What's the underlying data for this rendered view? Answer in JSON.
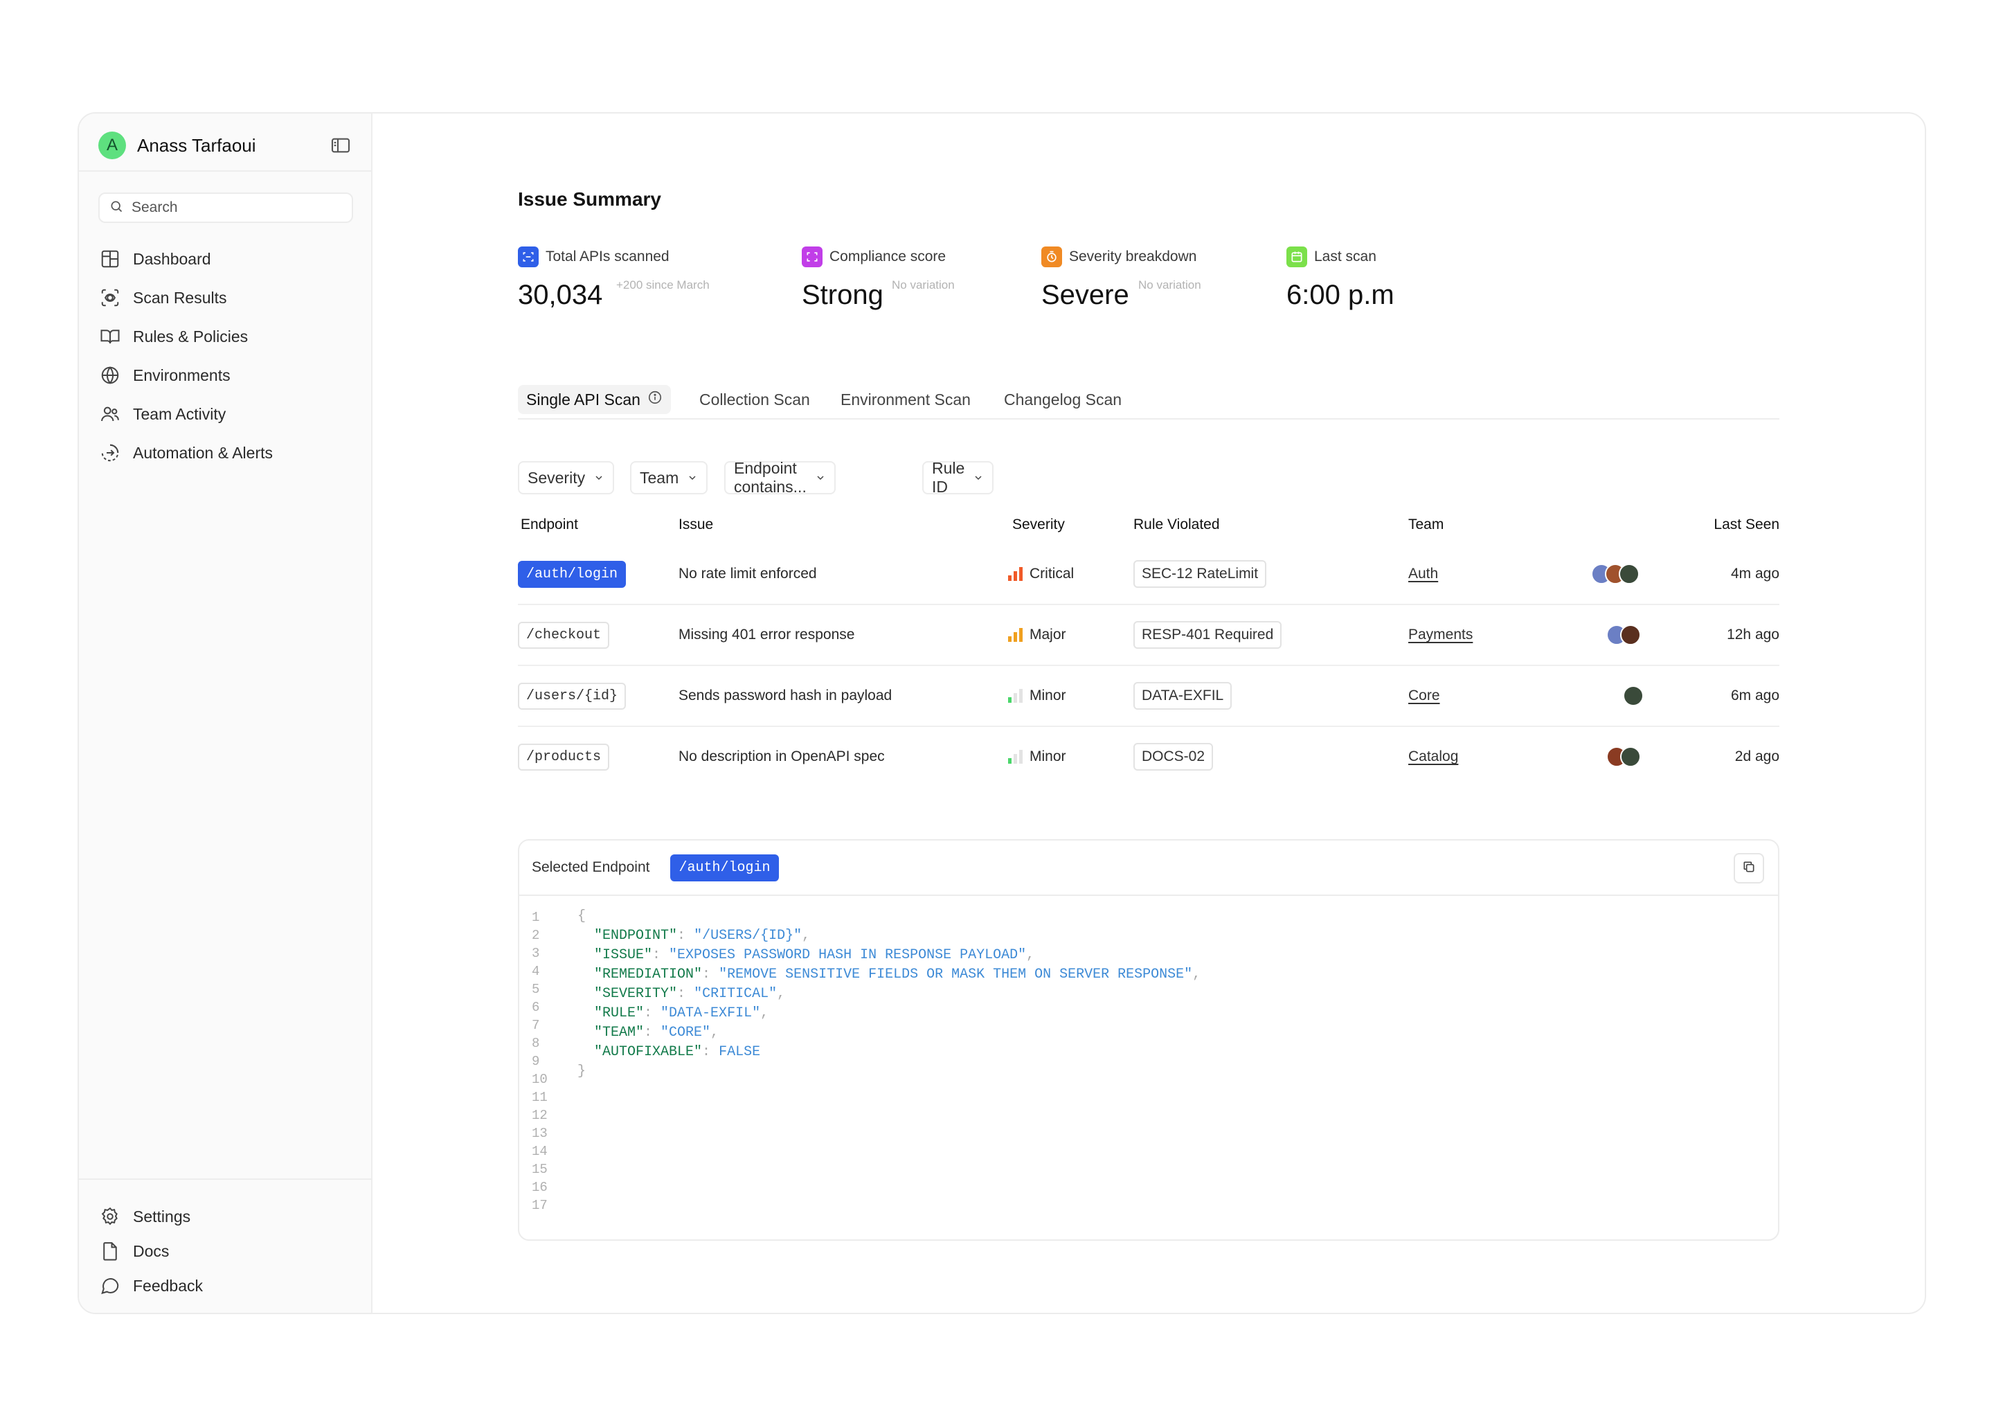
{
  "sidebar": {
    "user": {
      "initial": "A",
      "name": "Anass Tarfaoui"
    },
    "search_placeholder": "Search",
    "items": [
      {
        "label": "Dashboard",
        "icon": "layout-grid-icon"
      },
      {
        "label": "Scan Results",
        "icon": "scan-eye-icon"
      },
      {
        "label": "Rules & Policies",
        "icon": "book-open-icon"
      },
      {
        "label": "Environments",
        "icon": "globe-icon"
      },
      {
        "label": "Team Activity",
        "icon": "users-icon"
      },
      {
        "label": "Automation & Alerts",
        "icon": "circle-arrow-icon"
      }
    ],
    "bottom_items": [
      {
        "label": "Settings",
        "icon": "gear-icon"
      },
      {
        "label": "Docs",
        "icon": "file-icon"
      },
      {
        "label": "Feedback",
        "icon": "message-circle-icon"
      }
    ]
  },
  "main": {
    "title": "Issue Summary",
    "stats": [
      {
        "label": "Total APIs scanned",
        "value": "30,034",
        "sub": "+200 since March",
        "color": "#2f5fe8"
      },
      {
        "label": "Compliance score",
        "value": "Strong",
        "sub": "No variation",
        "color": "#c13ee8"
      },
      {
        "label": "Severity breakdown",
        "value": "Severe",
        "sub": "No variation",
        "color": "#f08a24"
      },
      {
        "label": "Last scan",
        "value": "6:00 p.m",
        "sub": "",
        "color": "#7be04a"
      }
    ],
    "tabs": [
      "Single API Scan",
      "Collection Scan",
      "Environment Scan",
      "Changelog Scan"
    ],
    "active_tab": "Single API Scan",
    "filters": [
      "Severity",
      "Team",
      "Endpoint contains...",
      "Rule ID"
    ],
    "table": {
      "headers": {
        "endpoint": "Endpoint",
        "issue": "Issue",
        "severity": "Severity",
        "rule": "Rule Violated",
        "team": "Team",
        "last_seen": "Last Seen"
      },
      "rows": [
        {
          "endpoint": "/auth/login",
          "issue": "No rate limit enforced",
          "severity": "Critical",
          "rule": "SEC-12 RateLimit",
          "team": "Auth",
          "last_seen": "4m ago"
        },
        {
          "endpoint": "/checkout",
          "issue": "Missing 401 error response",
          "severity": "Major",
          "rule": "RESP-401 Required",
          "team": "Payments",
          "last_seen": "12h ago"
        },
        {
          "endpoint": "/users/{id}",
          "issue": "Sends password hash in payload",
          "severity": "Minor",
          "rule": "DATA-EXFIL",
          "team": "Core",
          "last_seen": "6m ago"
        },
        {
          "endpoint": "/products",
          "issue": "No description in OpenAPI spec",
          "severity": "Minor",
          "rule": "DOCS-02",
          "team": "Catalog",
          "last_seen": "2d ago"
        }
      ]
    },
    "severity_colors": {
      "critical": "#f05a28",
      "major": "#f0a020",
      "minor": "#4ad66a",
      "empty": "#e3e3e3"
    },
    "panel": {
      "label": "Selected Endpoint",
      "endpoint": "/auth/login",
      "line_numbers": [
        "1",
        "2",
        "3",
        "4",
        "5",
        "6",
        "7",
        "8",
        "9",
        "10",
        "11",
        "12",
        "13",
        "14",
        "15",
        "16",
        "17"
      ],
      "json": {
        "open": "{",
        "close": "}",
        "entries": [
          {
            "key": "\"ENDPOINT\"",
            "value": "\"/USERS/{ID}\""
          },
          {
            "key": "\"ISSUE\"",
            "value": "\"EXPOSES PASSWORD HASH IN RESPONSE PAYLOAD\""
          },
          {
            "key": "\"REMEDIATION\"",
            "value": "\"REMOVE SENSITIVE FIELDS OR MASK THEM ON SERVER RESPONSE\""
          },
          {
            "key": "\"SEVERITY\"",
            "value": "\"CRITICAL\""
          },
          {
            "key": "\"RULE\"",
            "value": "\"DATA-EXFIL\""
          },
          {
            "key": "\"TEAM\"",
            "value": "\"CORE\""
          },
          {
            "key": "\"AUTOFIXABLE\"",
            "value": "FALSE"
          }
        ]
      }
    }
  }
}
